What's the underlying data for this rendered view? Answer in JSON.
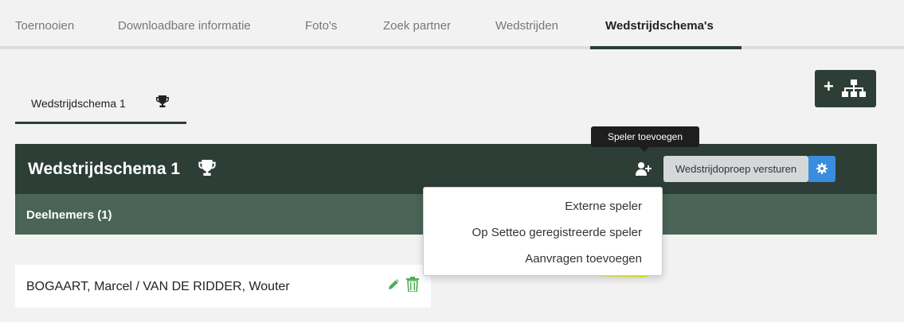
{
  "top_tabs": [
    {
      "label": "Toernooien",
      "active": false
    },
    {
      "label": "Downloadbare informatie",
      "active": false
    },
    {
      "label": "Foto's",
      "active": false
    },
    {
      "label": "Zoek partner",
      "active": false
    },
    {
      "label": "Wedstrijden",
      "active": false
    },
    {
      "label": "Wedstrijdschema's",
      "active": true
    }
  ],
  "schema_tab": {
    "label": "Wedstrijdschema 1",
    "icon": "trophy-icon"
  },
  "add_schema_button": {
    "icon": "plus-tree-icon"
  },
  "tooltip": {
    "text": "Speler toevoegen"
  },
  "panel": {
    "title": "Wedstrijdschema 1",
    "send_call_label": "Wedstrijdoproep versturen",
    "participants_label": "Deelnemers (1)"
  },
  "dropdown": {
    "items": [
      "Externe speler",
      "Op Setteo geregistreerde speler",
      "Aanvragen toevoegen"
    ],
    "highlighted_index": 2
  },
  "players": [
    {
      "name": "BOGAART, Marcel / VAN DE RIDDER, Wouter"
    }
  ],
  "colors": {
    "dark_green": "#2c3e36",
    "mid_green": "#4a6458",
    "blue": "#3a8dde",
    "icon_green": "#4caf50",
    "highlight": "#f3f53a"
  }
}
